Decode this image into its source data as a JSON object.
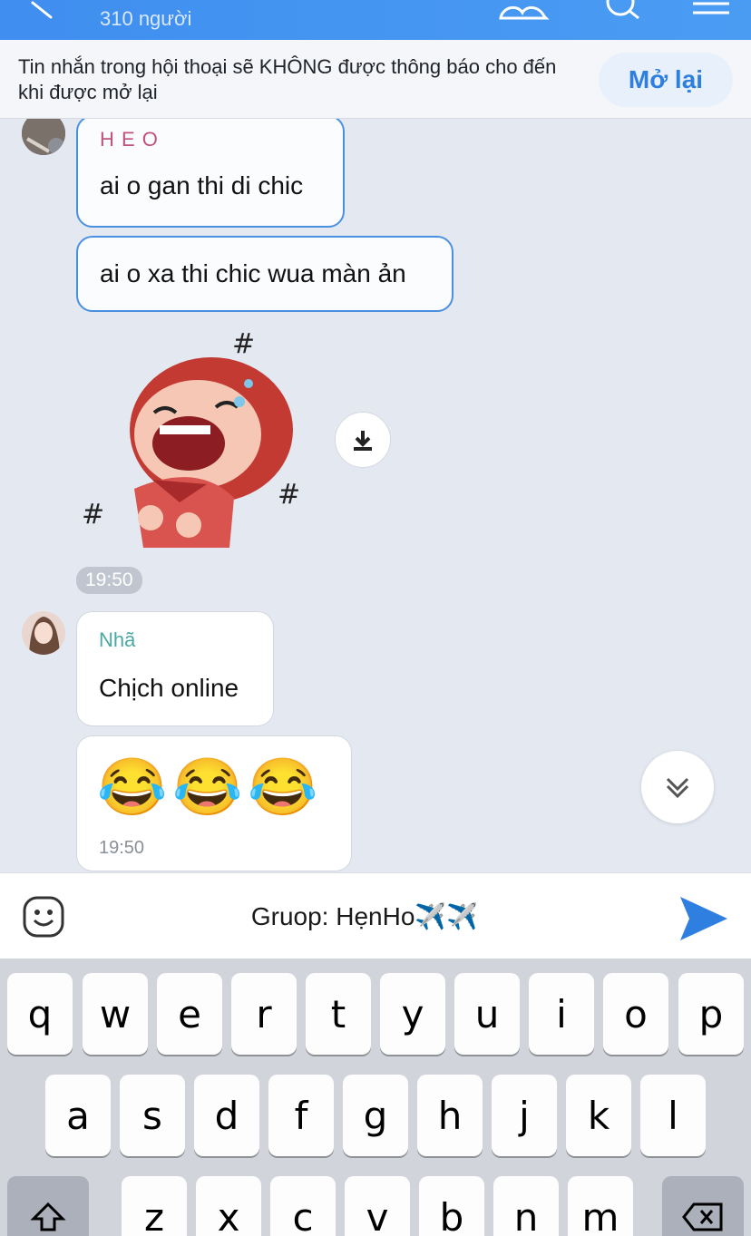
{
  "header": {
    "back_icon": "chevron-left-icon",
    "member_count": "310 người",
    "icons": [
      "group-members-icon",
      "search-icon",
      "menu-icon"
    ],
    "color": "#3f8ef0"
  },
  "banner": {
    "text": "Tin nhắn trong hội thoại sẽ KHÔNG được thông báo cho đến khi được mở lại",
    "button_label": "Mở lại"
  },
  "messages": {
    "m1": {
      "sender": "H E O",
      "text": "ai o gan thi di chic",
      "sender_color": "#c0527e"
    },
    "m2": {
      "text": "ai o xa thi chic wua màn ản"
    },
    "sticker": {
      "description_icon": "laughing-girl-sticker",
      "time": "19:50"
    },
    "m3": {
      "sender": "Nhã",
      "text": "Chịch online",
      "sender_color": "#4aa9a4"
    },
    "m4": {
      "text": "😂😂😂",
      "time": "19:50"
    }
  },
  "composer": {
    "value": "Gruop: HẹnHo✈️✈️",
    "emoji_icon": "smile-icon",
    "send_icon": "send-icon"
  },
  "keyboard": {
    "row1": [
      "q",
      "w",
      "e",
      "r",
      "t",
      "y",
      "u",
      "i",
      "o",
      "p"
    ],
    "row2": [
      "a",
      "s",
      "d",
      "f",
      "g",
      "h",
      "j",
      "k",
      "l"
    ],
    "row3": [
      "z",
      "x",
      "c",
      "v",
      "b",
      "n",
      "m"
    ],
    "shift_icon": "shift-icon",
    "backspace_icon": "backspace-icon"
  }
}
